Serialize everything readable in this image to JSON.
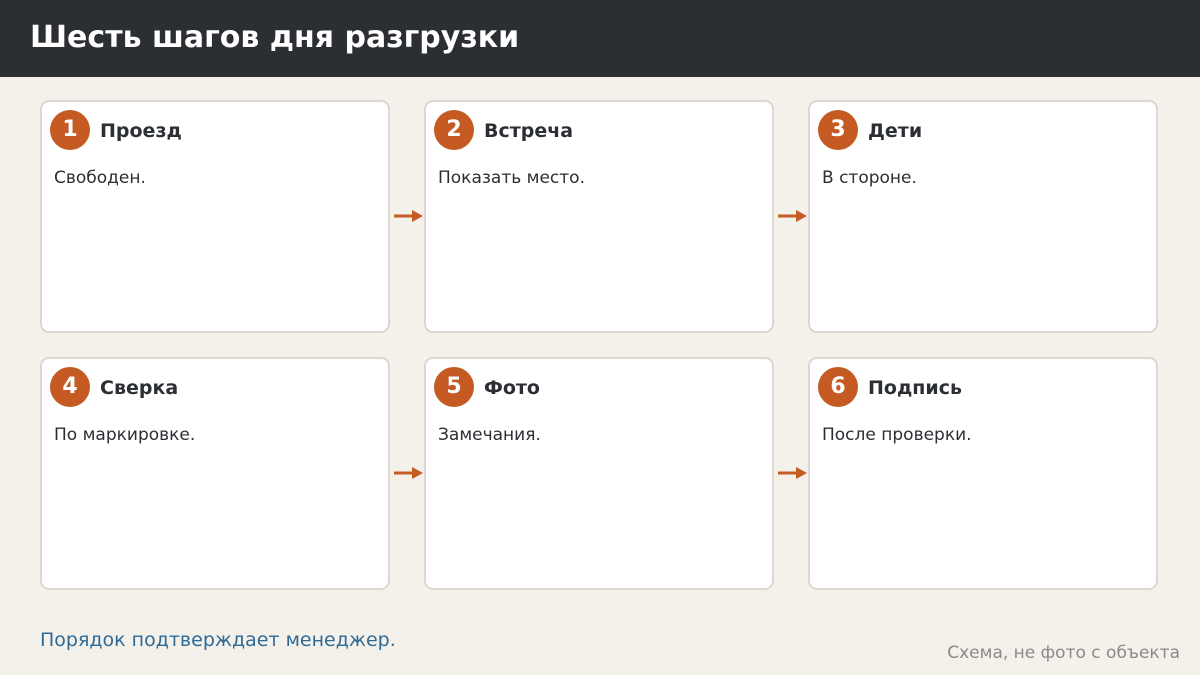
{
  "header": {
    "title": "Шесть шагов дня разгрузки"
  },
  "steps": [
    {
      "number": "1",
      "title": "Проезд",
      "text": "Свободен."
    },
    {
      "number": "2",
      "title": "Встреча",
      "text": "Показать место."
    },
    {
      "number": "3",
      "title": "Дети",
      "text": "В стороне."
    },
    {
      "number": "4",
      "title": "Сверка",
      "text": "По маркировке."
    },
    {
      "number": "5",
      "title": "Фото",
      "text": "Замечания."
    },
    {
      "number": "6",
      "title": "Подпись",
      "text": "После проверки."
    }
  ],
  "footer": {
    "note": "Порядок подтверждает менеджер.",
    "caption": "Схема, не фото с объекта"
  },
  "colors": {
    "accent": "#c55a23",
    "header_bg": "#2b2e33",
    "background": "#f4f1eb",
    "note": "#2e6a96"
  }
}
